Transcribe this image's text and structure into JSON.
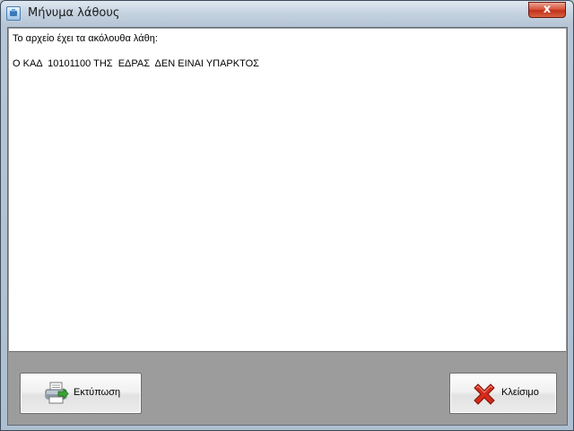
{
  "window": {
    "title": "Μήνυμα λάθους",
    "close_glyph": "x"
  },
  "message": {
    "heading": "Το αρχείο έχει τα ακόλουθα λάθη:",
    "lines": [
      "Ο ΚΑΔ  10101100 ΤΗΣ  ΕΔΡΑΣ  ΔΕΝ ΕΙΝΑΙ ΥΠΑΡΚΤΟΣ"
    ]
  },
  "buttons": {
    "print": {
      "label": "Εκτύπωση",
      "icon": "printer-icon"
    },
    "close": {
      "label": "Κλείσιμο",
      "icon": "red-x-icon"
    }
  },
  "colors": {
    "client_background": "#9c9c9c",
    "close_button": "#c0301a",
    "x_icon": "#d42a1a",
    "printer_arrow": "#3aa335"
  }
}
